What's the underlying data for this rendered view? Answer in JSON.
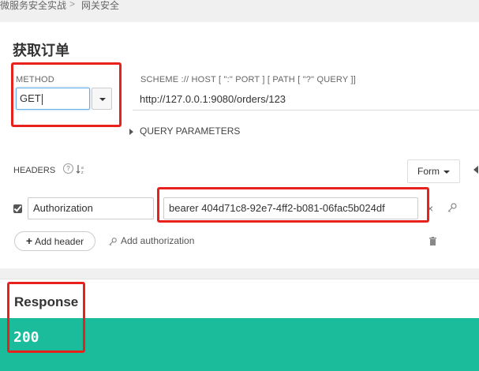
{
  "breadcrumb": {
    "parent": "微服务安全实战",
    "separator": ">",
    "current": "网关安全"
  },
  "request": {
    "title": "获取订单",
    "method_label": "METHOD",
    "method_value": "GET",
    "url_label": "SCHEME :// HOST [ \":\" PORT ] [ PATH [ \"?\" QUERY ]]",
    "url_value": "http://127.0.0.1:9080/orders/123",
    "query_params_label": "QUERY PARAMETERS"
  },
  "headers": {
    "label": "HEADERS",
    "help_glyph": "?",
    "sort_glyph": "↓a z",
    "form_label": "Form",
    "rows": [
      {
        "enabled": true,
        "name": "Authorization",
        "value": "bearer 404d71c8-92e7-4ff2-b081-06fac5b024df"
      }
    ],
    "remove_glyph": "×",
    "add_header_plus": "+",
    "add_header_label": "Add header",
    "add_authorization_label": "Add authorization"
  },
  "response": {
    "title": "Response",
    "status": "200"
  },
  "colors": {
    "status_bar": "#1abc9c",
    "highlight": "#e8211c",
    "focus": "#66afe9"
  }
}
